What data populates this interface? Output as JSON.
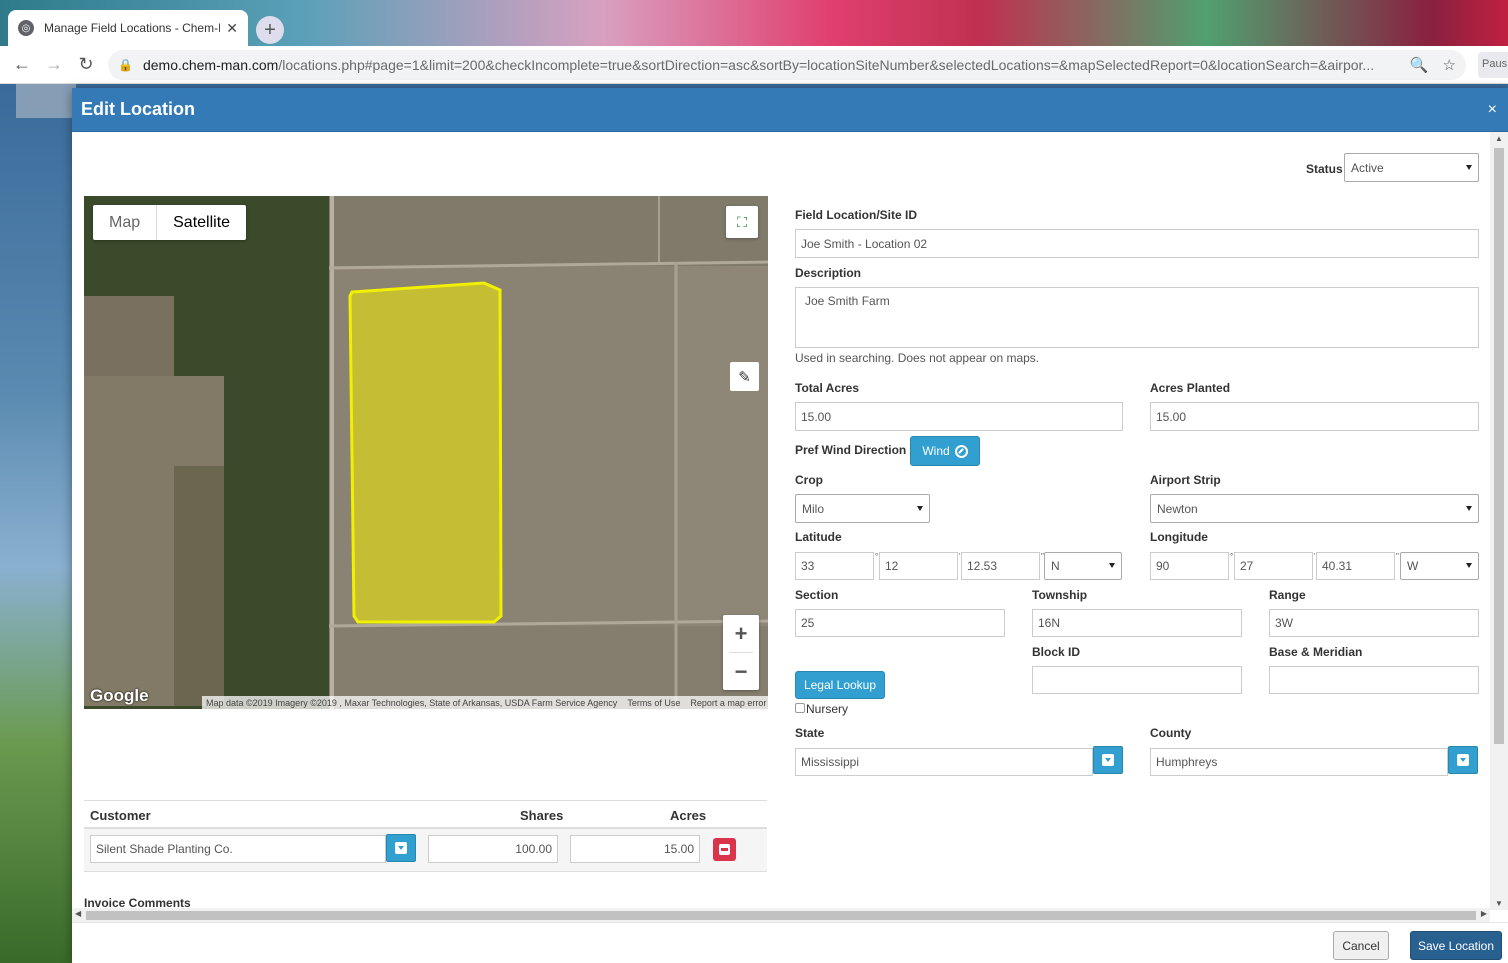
{
  "browser": {
    "tab_title": "Manage Field Locations - Chem-Man",
    "url_domain": "demo.chem-man.com",
    "url_path": "/locations.php#page=1&limit=200&checkIncomplete=true&sortDirection=asc&sortBy=locationSiteNumber&selectedLocations=&mapSelectedReport=0&locationSearch=&airpor...",
    "profile_label": "Paus"
  },
  "modal": {
    "title": "Edit Location",
    "close": "×"
  },
  "map": {
    "type_map": "Map",
    "type_satellite": "Satellite",
    "logo": "Google",
    "attribution": "Map data ©2019 Imagery ©2019 , Maxar Technologies, State of Arkansas, USDA Farm Service Agency",
    "terms": "Terms of Use",
    "report": "Report a map error",
    "zoom_in": "+",
    "zoom_out": "−"
  },
  "form": {
    "status_label": "Status",
    "status_value": "Active",
    "site_id_label": "Field Location/Site ID",
    "site_id_value": "Joe Smith - Location 02",
    "description_label": "Description",
    "description_value": "Joe Smith Farm",
    "description_help": "Used in searching. Does not appear on maps.",
    "total_acres_label": "Total Acres",
    "total_acres_value": "15.00",
    "acres_planted_label": "Acres Planted",
    "acres_planted_value": "15.00",
    "wind_label": "Pref Wind Direction",
    "wind_button": "Wind",
    "crop_label": "Crop",
    "crop_value": "Milo",
    "airport_label": "Airport Strip",
    "airport_value": "Newton",
    "latitude_label": "Latitude",
    "lat_deg": "33",
    "lat_min": "12",
    "lat_sec": "12.53",
    "lat_dir": "N",
    "longitude_label": "Longitude",
    "lon_deg": "90",
    "lon_min": "27",
    "lon_sec": "40.31",
    "lon_dir": "W",
    "section_label": "Section",
    "section_value": "25",
    "township_label": "Township",
    "township_value": "16N",
    "range_label": "Range",
    "range_value": "3W",
    "block_label": "Block ID",
    "block_value": "",
    "base_label": "Base & Meridian",
    "base_value": "",
    "legal_button": "Legal Lookup",
    "nursery_label": "Nursery",
    "state_label": "State",
    "state_value": "Mississippi",
    "county_label": "County",
    "county_value": "Humphreys"
  },
  "customers": {
    "headers": [
      "Customer",
      "Shares",
      "Acres"
    ],
    "rows": [
      {
        "customer": "Silent Shade Planting Co.",
        "shares": "100.00",
        "acres": "15.00"
      }
    ]
  },
  "invoice_label": "Invoice Comments",
  "footer": {
    "cancel": "Cancel",
    "save": "Save Location"
  }
}
